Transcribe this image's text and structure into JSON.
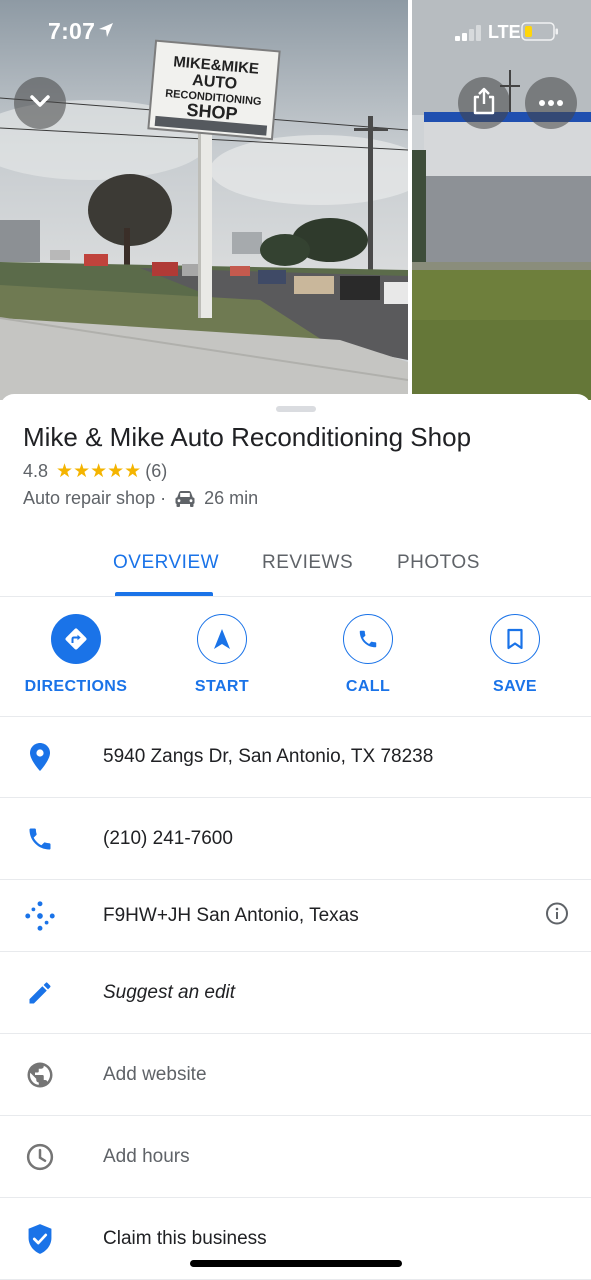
{
  "status_bar": {
    "time": "7:07",
    "network": "LTE"
  },
  "photo_sign": {
    "line1": "MIKE&MIKE",
    "line2": "AUTO",
    "line3": "RECONDITIONING",
    "line4": "SHOP"
  },
  "place": {
    "name": "Mike & Mike Auto Reconditioning Shop",
    "rating": "4.8",
    "stars": "★★★★★",
    "review_count": "(6)",
    "category": "Auto repair shop ·",
    "drive_time": "26 min"
  },
  "tabs": [
    {
      "label": "OVERVIEW",
      "active": true
    },
    {
      "label": "REVIEWS",
      "active": false
    },
    {
      "label": "PHOTOS",
      "active": false
    }
  ],
  "actions": [
    {
      "label": "DIRECTIONS",
      "icon": "directions-icon"
    },
    {
      "label": "START",
      "icon": "navigation-arrow-icon"
    },
    {
      "label": "CALL",
      "icon": "phone-icon"
    },
    {
      "label": "SAVE",
      "icon": "bookmark-icon"
    }
  ],
  "info": {
    "address": "5940 Zangs Dr, San Antonio, TX 78238",
    "phone": "(210) 241-7600",
    "plus_code": "F9HW+JH San Antonio, Texas",
    "suggest_edit": "Suggest an edit",
    "add_website": "Add website",
    "add_hours": "Add hours",
    "claim": "Claim this business"
  },
  "colors": {
    "accent": "#1a73e8",
    "star": "#f4b400",
    "muted_text": "#5f6368"
  }
}
